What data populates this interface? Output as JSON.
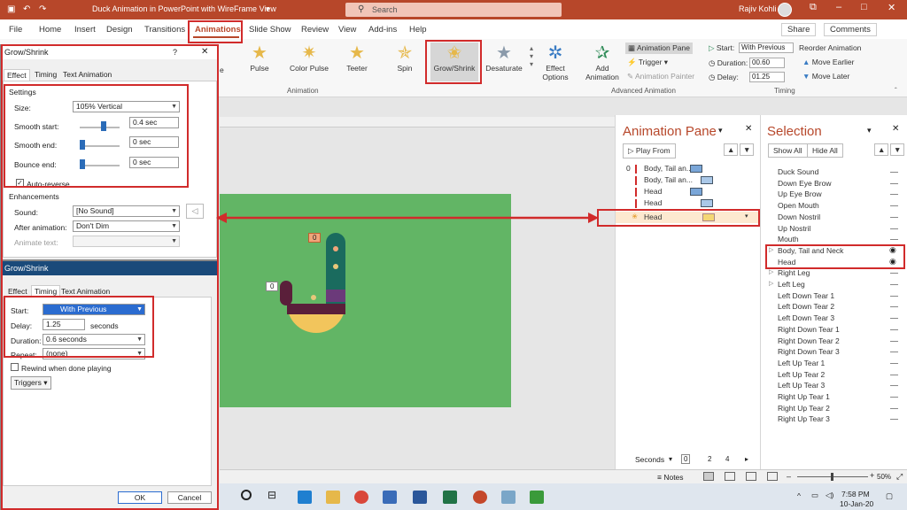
{
  "titlebar": {
    "doc_title": "Duck Animation in PowerPoint with WireFrame View",
    "search_placeholder": "Search",
    "user_name": "Rajiv Kohli",
    "save_icon": "save-icon",
    "undo_icon": "undo-icon",
    "redo_icon": "redo-icon",
    "color": "#b7472a"
  },
  "ribbon_tabs": [
    "File",
    "Home",
    "Insert",
    "Design",
    "Transitions",
    "Animations",
    "Slide Show",
    "Review",
    "View",
    "Add-ins",
    "Help"
  ],
  "ribbon_actions": {
    "share": "Share",
    "comments": "Comments"
  },
  "ribbon": {
    "gallery": [
      {
        "label": "Pulse"
      },
      {
        "label": "Color Pulse"
      },
      {
        "label": "Teeter"
      },
      {
        "label": "Spin"
      },
      {
        "label": "Grow/Shrink"
      },
      {
        "label": "Desaturate"
      }
    ],
    "effect_options": "Effect\nOptions",
    "effect_options_l1": "Effect",
    "effect_options_l2": "Options",
    "animation_group": "Animation",
    "add_animation_l1": "Add",
    "add_animation_l2": "Animation",
    "animation_pane": "Animation Pane",
    "trigger": "Trigger",
    "animation_painter": "Animation Painter",
    "advanced_group": "Advanced Animation",
    "start_label": "Start:",
    "start_value": "With Previous",
    "duration_label": "Duration:",
    "duration_value": "00.60",
    "delay_label": "Delay:",
    "delay_value": "01.25",
    "reorder": "Reorder Animation",
    "move_earlier": "Move Earlier",
    "move_later": "Move Later",
    "timing_group": "Timing"
  },
  "dialog_effect": {
    "title": "Grow/Shrink",
    "help": "?",
    "tabs": [
      "Effect",
      "Timing",
      "Text Animation"
    ],
    "settings_header": "Settings",
    "size_label": "Size:",
    "size_value": "105% Vertical",
    "smooth_start_label": "Smooth start:",
    "smooth_start_value": "0.4 sec",
    "smooth_end_label": "Smooth end:",
    "smooth_end_value": "0 sec",
    "bounce_end_label": "Bounce end:",
    "bounce_end_value": "0 sec",
    "auto_reverse": "Auto-reverse",
    "enhancements_header": "Enhancements",
    "sound_label": "Sound:",
    "sound_value": "[No Sound]",
    "after_label": "After animation:",
    "after_value": "Don't Dim",
    "animate_text_label": "Animate text:"
  },
  "dialog_timing": {
    "title": "Grow/Shrink",
    "tabs": [
      "Effect",
      "Timing",
      "Text Animation"
    ],
    "start_label": "Start:",
    "start_value": "With Previous",
    "delay_label": "Delay:",
    "delay_value": "1.25",
    "delay_unit": "seconds",
    "duration_label": "Duration:",
    "duration_value": "0.6 seconds",
    "repeat_label": "Repeat:",
    "repeat_value": "(none)",
    "rewind": "Rewind when done playing",
    "triggers": "Triggers",
    "ok": "OK",
    "cancel": "Cancel"
  },
  "slide": {
    "badge_top": "0",
    "badge_left": "0",
    "bg_color": "#62b565"
  },
  "animation_pane": {
    "title": "Animation Pane",
    "play_from": "Play From",
    "items": [
      {
        "num": "0",
        "label": "Body, Tail an..."
      },
      {
        "num": "",
        "label": "Body, Tail an..."
      },
      {
        "num": "",
        "label": "Head"
      },
      {
        "num": "",
        "label": "Head"
      },
      {
        "num": "",
        "label": "Head"
      }
    ],
    "seconds_label": "Seconds",
    "ticks": [
      "0",
      "2",
      "4"
    ]
  },
  "selection_pane": {
    "title": "Selection",
    "show_all": "Show All",
    "hide_all": "Hide All",
    "items": [
      "Duck Sound",
      "Down Eye Brow",
      "Up Eye Brow",
      "Open Mouth",
      "Down Nostril",
      "Up Nostril",
      "Mouth",
      "Body, Tail and Neck",
      "Head",
      "Right Leg",
      "Left Leg",
      "Left Down Tear 1",
      "Left Down Tear 2",
      "Left Down Tear 3",
      "Right Down Tear 1",
      "Right Down Tear 2",
      "Right Down Tear 3",
      "Left Up Tear 1",
      "Left Up Tear 2",
      "Left Up Tear 3",
      "Right Up Tear 1",
      "Right Up Tear 2",
      "Right Up Tear 3"
    ]
  },
  "statusbar": {
    "notes": "Notes",
    "zoom": "50%"
  },
  "taskbar": {
    "time": "7:58 PM",
    "date": "10-Jan-20"
  }
}
